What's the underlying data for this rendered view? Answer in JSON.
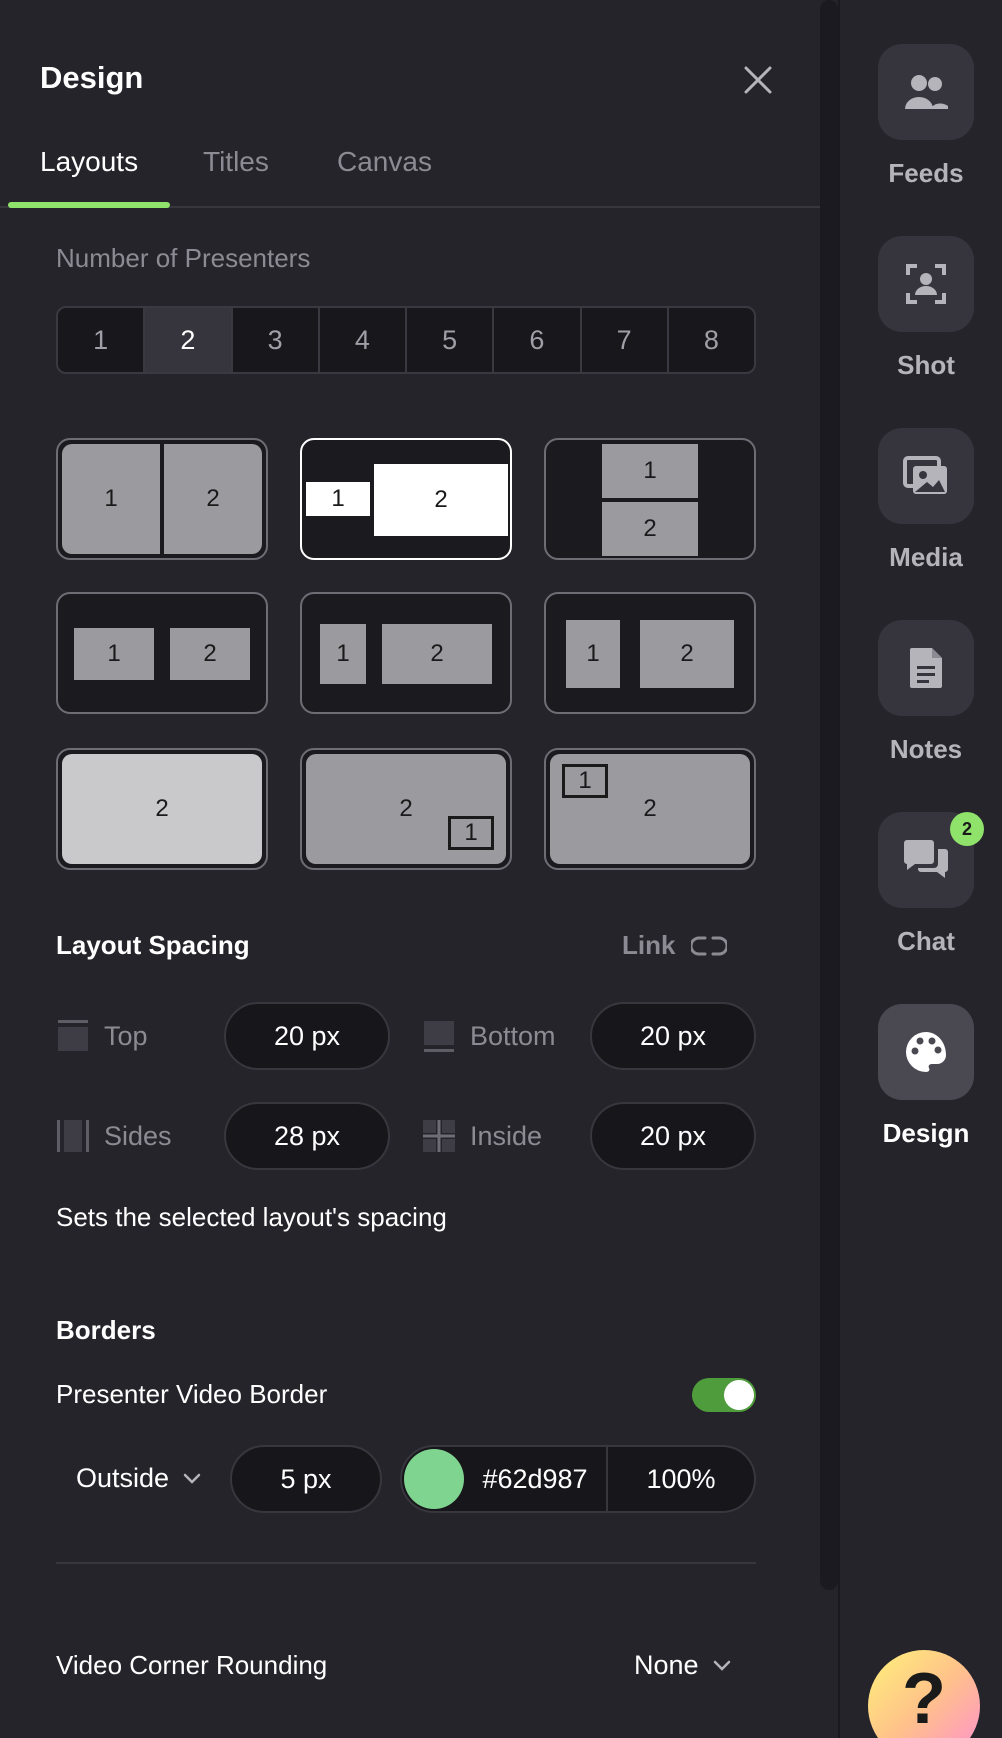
{
  "panel": {
    "title": "Design"
  },
  "tabs": [
    {
      "label": "Layouts",
      "active": true
    },
    {
      "label": "Titles",
      "active": false
    },
    {
      "label": "Canvas",
      "active": false
    }
  ],
  "presenters": {
    "label": "Number of Presenters",
    "options": [
      "1",
      "2",
      "3",
      "4",
      "5",
      "6",
      "7",
      "8"
    ],
    "selected": "2"
  },
  "layouts": {
    "tile_1": "1",
    "tile_2": "2",
    "selected_index": 1
  },
  "spacing": {
    "title": "Layout Spacing",
    "link_label": "Link",
    "top_label": "Top",
    "top_value": "20 px",
    "bottom_label": "Bottom",
    "bottom_value": "20 px",
    "sides_label": "Sides",
    "sides_value": "28 px",
    "inside_label": "Inside",
    "inside_value": "20 px",
    "help": "Sets the selected layout's spacing"
  },
  "borders": {
    "title": "Borders",
    "video_border_label": "Presenter Video Border",
    "video_border_enabled": true,
    "position": "Outside",
    "width": "5 px",
    "color_hex": "#62d987",
    "swatch_color": "#7fd490",
    "opacity": "100%"
  },
  "corner": {
    "label": "Video Corner Rounding",
    "value": "None"
  },
  "rail": {
    "items": [
      {
        "label": "Feeds",
        "icon": "people-icon"
      },
      {
        "label": "Shot",
        "icon": "portrait-frame-icon"
      },
      {
        "label": "Media",
        "icon": "images-icon"
      },
      {
        "label": "Notes",
        "icon": "document-icon"
      },
      {
        "label": "Chat",
        "icon": "chat-bubbles-icon",
        "badge": "2"
      },
      {
        "label": "Design",
        "icon": "palette-icon",
        "active": true
      }
    ],
    "help_glyph": "?"
  },
  "colors": {
    "accent": "#8fe26a",
    "toggle_on": "#4f9c3c",
    "background": "#25242b"
  }
}
